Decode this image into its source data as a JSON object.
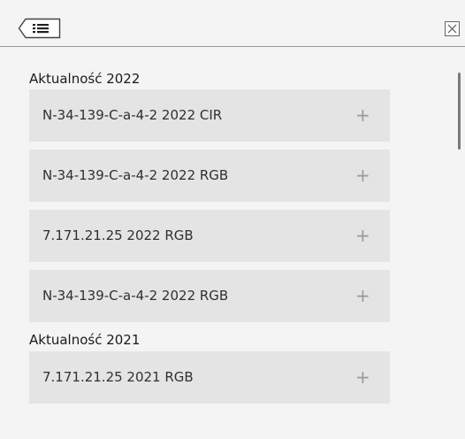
{
  "header": {
    "back_icon": "list-back-icon",
    "close_icon": "close-icon"
  },
  "sections": [
    {
      "title": "Aktualność 2022",
      "items": [
        {
          "label": "N-34-139-C-a-4-2 2022 CIR",
          "action": "+"
        },
        {
          "label": "N-34-139-C-a-4-2 2022 RGB",
          "action": "+"
        },
        {
          "label": "7.171.21.25 2022 RGB",
          "action": "+"
        },
        {
          "label": "N-34-139-C-a-4-2 2022 RGB",
          "action": "+"
        }
      ]
    },
    {
      "title": "Aktualność 2021",
      "items": [
        {
          "label": "7.171.21.25 2021 RGB",
          "action": "+"
        }
      ]
    }
  ],
  "colors": {
    "panel_bg": "#f4f4f4",
    "item_bg": "#e4e4e4",
    "text": "#303030",
    "icon": "#9a9a9a"
  }
}
